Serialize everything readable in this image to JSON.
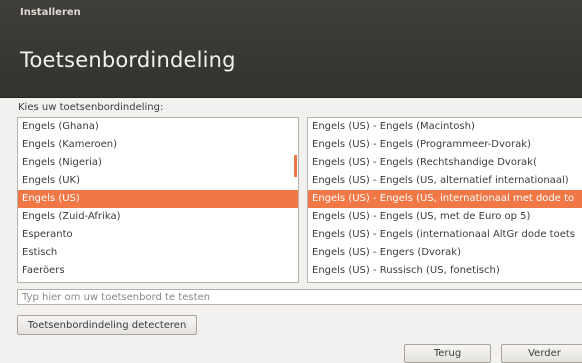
{
  "window": {
    "title": "Installeren"
  },
  "page": {
    "title": "Toetsenbordindeling"
  },
  "prompt": "Kies uw toetsenbordindeling:",
  "layouts": [
    {
      "label": "Engels (Ghana)",
      "selected": false
    },
    {
      "label": "Engels (Kameroen)",
      "selected": false
    },
    {
      "label": "Engels (Nigeria)",
      "selected": false
    },
    {
      "label": "Engels (UK)",
      "selected": false
    },
    {
      "label": "Engels (US)",
      "selected": true
    },
    {
      "label": "Engels (Zuid-Afrika)",
      "selected": false
    },
    {
      "label": "Esperanto",
      "selected": false
    },
    {
      "label": "Estisch",
      "selected": false
    },
    {
      "label": "Faeröers",
      "selected": false
    }
  ],
  "variants": [
    {
      "label": "Engels (US) - Engels (Macintosh)",
      "selected": false
    },
    {
      "label": "Engels (US) - Engels (Programmeer-Dvorak)",
      "selected": false
    },
    {
      "label": "Engels (US) - Engels (Rechtshandige Dvorak(",
      "selected": false
    },
    {
      "label": "Engels (US) - Engels (US, alternatief internationaal)",
      "selected": false
    },
    {
      "label": "Engels (US) - Engels (US, internationaal met dode to",
      "selected": true
    },
    {
      "label": "Engels (US) - Engels (US, met de Euro op 5)",
      "selected": false
    },
    {
      "label": "Engels (US) - Engels (internationaal AltGr dode toets",
      "selected": false
    },
    {
      "label": "Engels (US) - Engers (Dvorak)",
      "selected": false
    },
    {
      "label": "Engels (US) - Russisch (US, fonetisch)",
      "selected": false
    }
  ],
  "test_input": {
    "value": "",
    "placeholder": "Typ hier om uw toetsenbord te testen"
  },
  "buttons": {
    "detect": "Toetsenbordindeling detecteren",
    "back": "Terug",
    "next": "Verder"
  },
  "colors": {
    "accent": "#f07746",
    "titlebar": "#3c3b37"
  }
}
